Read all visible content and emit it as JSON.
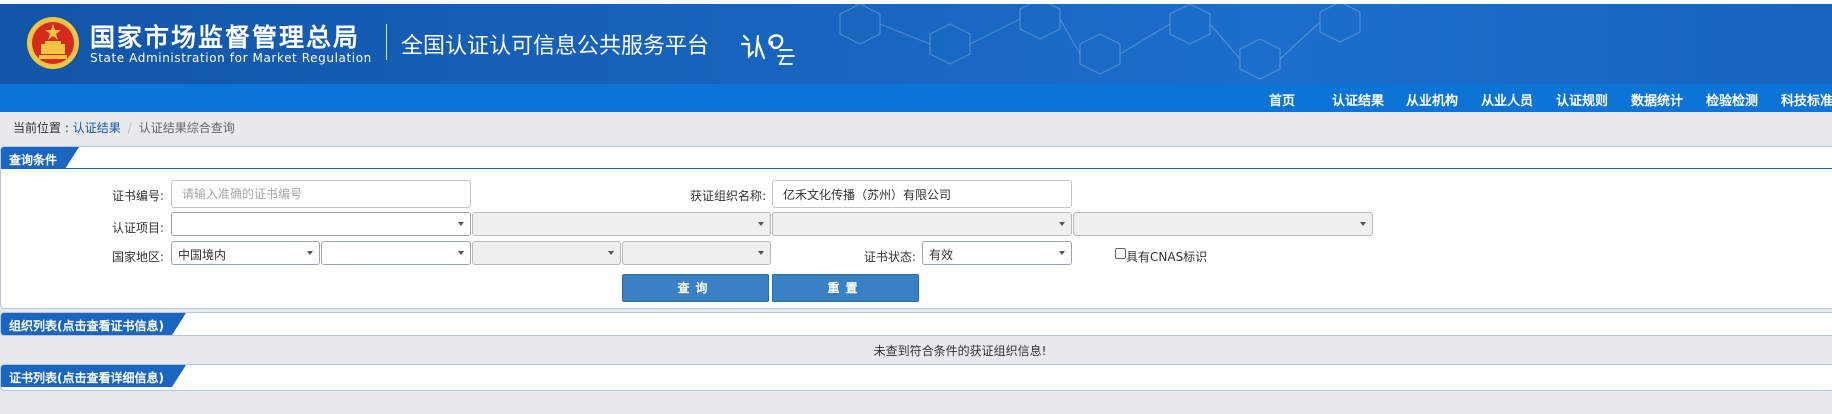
{
  "header": {
    "org_name_cn": "国家市场监督管理总局",
    "org_name_en": "State Administration  for  Market Regulation",
    "platform_title": "全国认证认可信息公共服务平台",
    "logo_text": "认云"
  },
  "nav": {
    "items": [
      {
        "label": "首页"
      },
      {
        "label": "认证结果"
      },
      {
        "label": "从业机构"
      },
      {
        "label": "从业人员"
      },
      {
        "label": "认证规则"
      },
      {
        "label": "数据统计"
      },
      {
        "label": "检验检测"
      },
      {
        "label": "科技标准"
      }
    ]
  },
  "breadcrumb": {
    "prefix": "当前位置 : ",
    "link": "认证结果",
    "separator": "/",
    "current": "认证结果综合查询"
  },
  "query": {
    "title": "查询条件",
    "cert_no_label": "证书编号:",
    "cert_no_placeholder": "请输入准确的证书编号",
    "cert_no_value": "",
    "org_name_label": "获证组织名称:",
    "org_name_value": "亿禾文化传播（苏州）有限公司",
    "project_label": "认证项目:",
    "project_selects": [
      "",
      "",
      "",
      ""
    ],
    "region_label": "国家地区:",
    "region_selects": [
      "中国境内",
      "",
      "",
      ""
    ],
    "status_label": "证书状态:",
    "status_value": "有效",
    "cnas_checked": false,
    "cnas_label": "具有CNAS标识",
    "search_button": "查询",
    "reset_button": "重置"
  },
  "org_list": {
    "title": "组织列表(点击查看证书信息)",
    "empty_message": "未查到符合条件的获证组织信息!"
  },
  "cert_list": {
    "title": "证书列表(点击查看详细信息)"
  },
  "colors": {
    "banner": "#1763bd",
    "nav": "#0b74d6",
    "panel_title": "#1a65c0",
    "button": "#3a80c4",
    "link": "#1a5aa8"
  }
}
